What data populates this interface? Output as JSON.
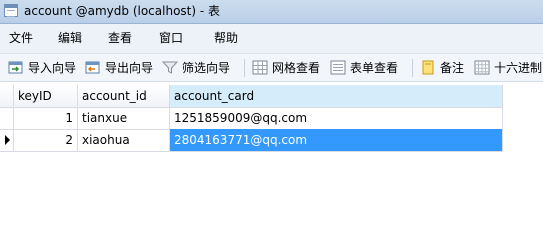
{
  "window": {
    "title": "account @amydb (localhost) - 表"
  },
  "menu": {
    "items": [
      "文件",
      "编辑",
      "查看",
      "窗口",
      "帮助"
    ]
  },
  "toolbar": {
    "import_label": "导入向导",
    "export_label": "导出向导",
    "filter_label": "筛选向导",
    "grid_view_label": "网格查看",
    "form_view_label": "表单查看",
    "memo_label": "备注",
    "hex_label": "十六进制"
  },
  "table": {
    "columns": [
      "keyID",
      "account_id",
      "account_card"
    ],
    "rows": [
      {
        "keyID": "1",
        "account_id": "tianxue",
        "account_card": "1251859009@qq.com"
      },
      {
        "keyID": "2",
        "account_id": "xiaohua",
        "account_card": "2804163771@qq.com"
      }
    ],
    "current_row": 2
  },
  "colors": {
    "selection": "#3399ff",
    "sorted_header": "#d5ecfa",
    "titlebar": "#c3d6ec"
  },
  "icons": [
    "table-icon",
    "import-icon",
    "export-icon",
    "filter-icon",
    "grid-view-icon",
    "form-view-icon",
    "memo-icon",
    "hex-icon",
    "row-pointer-icon"
  ]
}
